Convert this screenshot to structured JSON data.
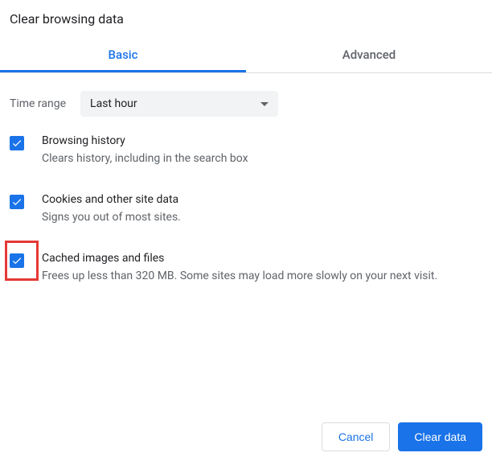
{
  "dialog": {
    "title": "Clear browsing data"
  },
  "tabs": {
    "basic": "Basic",
    "advanced": "Advanced"
  },
  "timeRange": {
    "label": "Time range",
    "selected": "Last hour"
  },
  "options": {
    "browsingHistory": {
      "title": "Browsing history",
      "desc": "Clears history, including in the search box"
    },
    "cookies": {
      "title": "Cookies and other site data",
      "desc": "Signs you out of most sites."
    },
    "cache": {
      "title": "Cached images and files",
      "desc": "Frees up less than 320 MB. Some sites may load more slowly on your next visit."
    }
  },
  "buttons": {
    "cancel": "Cancel",
    "clear": "Clear data"
  }
}
